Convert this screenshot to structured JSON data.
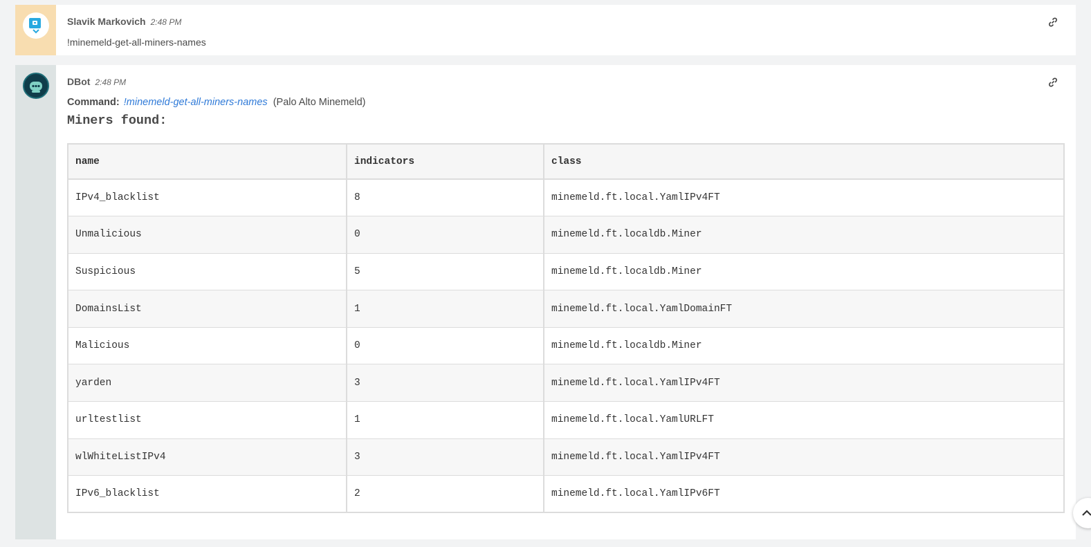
{
  "messages": {
    "user": {
      "author": "Slavik Markovich",
      "time": "2:48 PM",
      "text": "!minemeld-get-all-miners-names"
    },
    "bot": {
      "author": "DBot",
      "time": "2:48 PM",
      "command_label": "Command:",
      "command": "!minemeld-get-all-miners-names",
      "integration": "(Palo Alto Minemeld)",
      "heading": "Miners found:",
      "table": {
        "headers": [
          "name",
          "indicators",
          "class"
        ],
        "rows": [
          [
            "IPv4_blacklist",
            "8",
            "minemeld.ft.local.YamlIPv4FT"
          ],
          [
            "Unmalicious",
            "0",
            "minemeld.ft.localdb.Miner"
          ],
          [
            "Suspicious",
            "5",
            "minemeld.ft.localdb.Miner"
          ],
          [
            "DomainsList",
            "1",
            "minemeld.ft.local.YamlDomainFT"
          ],
          [
            "Malicious",
            "0",
            "minemeld.ft.localdb.Miner"
          ],
          [
            "yarden",
            "3",
            "minemeld.ft.local.YamlIPv4FT"
          ],
          [
            "urltestlist",
            "1",
            "minemeld.ft.local.YamlURLFT"
          ],
          [
            "wlWhiteListIPv4",
            "3",
            "minemeld.ft.local.YamlIPv4FT"
          ],
          [
            "IPv6_blacklist",
            "2",
            "minemeld.ft.local.YamlIPv6FT"
          ]
        ]
      }
    }
  },
  "icons": {
    "user_avatar": "chat-bubble-icon",
    "bot_avatar": "robot-icon",
    "permalink": "link-icon",
    "scroll_top": "chevron-up-icon"
  },
  "colors": {
    "user_gutter": "#f8ddb0",
    "bot_gutter": "#dde3e3",
    "command_link": "#2f7ad8"
  }
}
